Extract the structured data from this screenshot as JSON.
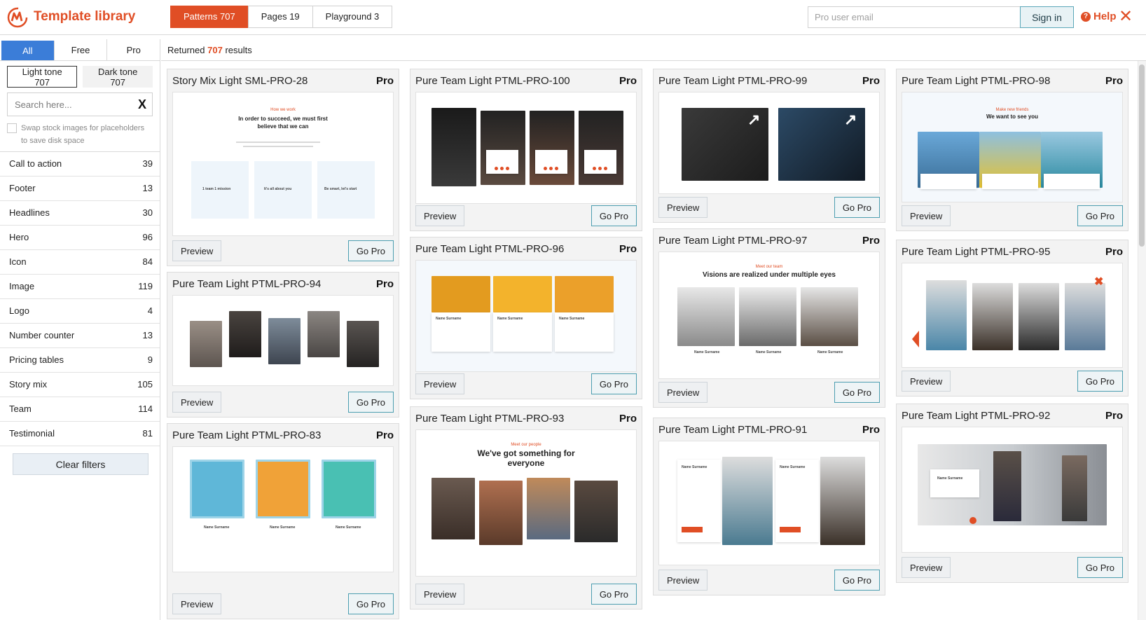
{
  "header": {
    "app_title": "Template library",
    "tabs": [
      {
        "label": "Patterns 707",
        "active": true
      },
      {
        "label": "Pages 19",
        "active": false
      },
      {
        "label": "Playground 3",
        "active": false
      }
    ],
    "email_placeholder": "Pro user email",
    "signin_label": "Sign in",
    "help_label": "Help",
    "help_icon": "question-circle-icon",
    "close_icon": "close-x-icon",
    "accent_color": "#e04e25"
  },
  "sidebar": {
    "filter_tabs": [
      "All",
      "Free",
      "Pro"
    ],
    "tone_buttons": [
      "Light tone 707",
      "Dark tone 707"
    ],
    "search_placeholder": "Search here...",
    "search_clear": "X",
    "swap_text": "Swap stock images for placeholders to save disk space",
    "categories": [
      {
        "label": "Call to action",
        "count": "39"
      },
      {
        "label": "Footer",
        "count": "13"
      },
      {
        "label": "Headlines",
        "count": "30"
      },
      {
        "label": "Hero",
        "count": "96"
      },
      {
        "label": "Icon",
        "count": "84"
      },
      {
        "label": "Image",
        "count": "119"
      },
      {
        "label": "Logo",
        "count": "4"
      },
      {
        "label": "Number counter",
        "count": "13"
      },
      {
        "label": "Pricing tables",
        "count": "9"
      },
      {
        "label": "Story mix",
        "count": "105"
      },
      {
        "label": "Team",
        "count": "114"
      },
      {
        "label": "Testimonial",
        "count": "81"
      }
    ],
    "clear_filters": "Clear filters"
  },
  "results": {
    "prefix": "Returned",
    "count": "707",
    "suffix": "results"
  },
  "cards": {
    "preview_label": "Preview",
    "gopro_label": "Go Pro",
    "badge": "Pro",
    "items": [
      {
        "title": "Story Mix Light SML-PRO-28"
      },
      {
        "title": "Pure Team Light PTML-PRO-94"
      },
      {
        "title": "Pure Team Light PTML-PRO-83"
      },
      {
        "title": "Pure Team Light PTML-PRO-100"
      },
      {
        "title": "Pure Team Light PTML-PRO-96"
      },
      {
        "title": "Pure Team Light PTML-PRO-93"
      },
      {
        "title": "Pure Team Light PTML-PRO-99"
      },
      {
        "title": "Pure Team Light PTML-PRO-97"
      },
      {
        "title": "Pure Team Light PTML-PRO-91"
      },
      {
        "title": "Pure Team Light PTML-PRO-98"
      },
      {
        "title": "Pure Team Light PTML-PRO-95"
      },
      {
        "title": "Pure Team Light PTML-PRO-92"
      }
    ]
  },
  "thumbnails": {
    "sml28_kicker": "How we work",
    "sml28_headline": "In order to succeed, we must first believe that we can",
    "sml28_cols": [
      "1 team 1 mission",
      "It's all about you",
      "Be smart, let's start"
    ],
    "pro93_kicker": "Meet our people",
    "pro93_headline": "We've got something for everyone",
    "pro97_kicker": "Meet our team",
    "pro97_headline": "Visions are realized under multiple eyes",
    "pro98_kicker": "Make new friends",
    "pro98_headline": "We want to see you",
    "name_surname": "Name Surname"
  }
}
